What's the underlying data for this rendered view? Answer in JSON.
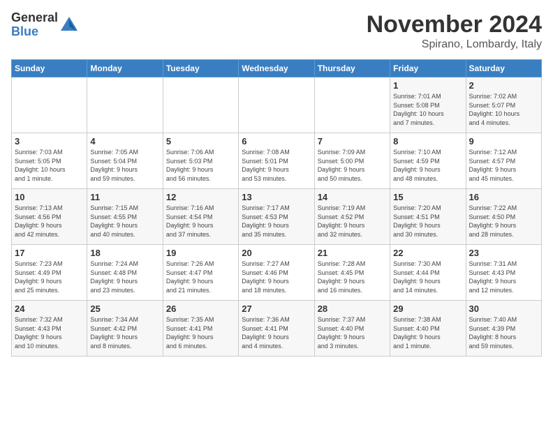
{
  "header": {
    "logo_general": "General",
    "logo_blue": "Blue",
    "month_title": "November 2024",
    "location": "Spirano, Lombardy, Italy"
  },
  "weekdays": [
    "Sunday",
    "Monday",
    "Tuesday",
    "Wednesday",
    "Thursday",
    "Friday",
    "Saturday"
  ],
  "weeks": [
    [
      {
        "day": "",
        "info": ""
      },
      {
        "day": "",
        "info": ""
      },
      {
        "day": "",
        "info": ""
      },
      {
        "day": "",
        "info": ""
      },
      {
        "day": "",
        "info": ""
      },
      {
        "day": "1",
        "info": "Sunrise: 7:01 AM\nSunset: 5:08 PM\nDaylight: 10 hours\nand 7 minutes."
      },
      {
        "day": "2",
        "info": "Sunrise: 7:02 AM\nSunset: 5:07 PM\nDaylight: 10 hours\nand 4 minutes."
      }
    ],
    [
      {
        "day": "3",
        "info": "Sunrise: 7:03 AM\nSunset: 5:05 PM\nDaylight: 10 hours\nand 1 minute."
      },
      {
        "day": "4",
        "info": "Sunrise: 7:05 AM\nSunset: 5:04 PM\nDaylight: 9 hours\nand 59 minutes."
      },
      {
        "day": "5",
        "info": "Sunrise: 7:06 AM\nSunset: 5:03 PM\nDaylight: 9 hours\nand 56 minutes."
      },
      {
        "day": "6",
        "info": "Sunrise: 7:08 AM\nSunset: 5:01 PM\nDaylight: 9 hours\nand 53 minutes."
      },
      {
        "day": "7",
        "info": "Sunrise: 7:09 AM\nSunset: 5:00 PM\nDaylight: 9 hours\nand 50 minutes."
      },
      {
        "day": "8",
        "info": "Sunrise: 7:10 AM\nSunset: 4:59 PM\nDaylight: 9 hours\nand 48 minutes."
      },
      {
        "day": "9",
        "info": "Sunrise: 7:12 AM\nSunset: 4:57 PM\nDaylight: 9 hours\nand 45 minutes."
      }
    ],
    [
      {
        "day": "10",
        "info": "Sunrise: 7:13 AM\nSunset: 4:56 PM\nDaylight: 9 hours\nand 42 minutes."
      },
      {
        "day": "11",
        "info": "Sunrise: 7:15 AM\nSunset: 4:55 PM\nDaylight: 9 hours\nand 40 minutes."
      },
      {
        "day": "12",
        "info": "Sunrise: 7:16 AM\nSunset: 4:54 PM\nDaylight: 9 hours\nand 37 minutes."
      },
      {
        "day": "13",
        "info": "Sunrise: 7:17 AM\nSunset: 4:53 PM\nDaylight: 9 hours\nand 35 minutes."
      },
      {
        "day": "14",
        "info": "Sunrise: 7:19 AM\nSunset: 4:52 PM\nDaylight: 9 hours\nand 32 minutes."
      },
      {
        "day": "15",
        "info": "Sunrise: 7:20 AM\nSunset: 4:51 PM\nDaylight: 9 hours\nand 30 minutes."
      },
      {
        "day": "16",
        "info": "Sunrise: 7:22 AM\nSunset: 4:50 PM\nDaylight: 9 hours\nand 28 minutes."
      }
    ],
    [
      {
        "day": "17",
        "info": "Sunrise: 7:23 AM\nSunset: 4:49 PM\nDaylight: 9 hours\nand 25 minutes."
      },
      {
        "day": "18",
        "info": "Sunrise: 7:24 AM\nSunset: 4:48 PM\nDaylight: 9 hours\nand 23 minutes."
      },
      {
        "day": "19",
        "info": "Sunrise: 7:26 AM\nSunset: 4:47 PM\nDaylight: 9 hours\nand 21 minutes."
      },
      {
        "day": "20",
        "info": "Sunrise: 7:27 AM\nSunset: 4:46 PM\nDaylight: 9 hours\nand 18 minutes."
      },
      {
        "day": "21",
        "info": "Sunrise: 7:28 AM\nSunset: 4:45 PM\nDaylight: 9 hours\nand 16 minutes."
      },
      {
        "day": "22",
        "info": "Sunrise: 7:30 AM\nSunset: 4:44 PM\nDaylight: 9 hours\nand 14 minutes."
      },
      {
        "day": "23",
        "info": "Sunrise: 7:31 AM\nSunset: 4:43 PM\nDaylight: 9 hours\nand 12 minutes."
      }
    ],
    [
      {
        "day": "24",
        "info": "Sunrise: 7:32 AM\nSunset: 4:43 PM\nDaylight: 9 hours\nand 10 minutes."
      },
      {
        "day": "25",
        "info": "Sunrise: 7:34 AM\nSunset: 4:42 PM\nDaylight: 9 hours\nand 8 minutes."
      },
      {
        "day": "26",
        "info": "Sunrise: 7:35 AM\nSunset: 4:41 PM\nDaylight: 9 hours\nand 6 minutes."
      },
      {
        "day": "27",
        "info": "Sunrise: 7:36 AM\nSunset: 4:41 PM\nDaylight: 9 hours\nand 4 minutes."
      },
      {
        "day": "28",
        "info": "Sunrise: 7:37 AM\nSunset: 4:40 PM\nDaylight: 9 hours\nand 3 minutes."
      },
      {
        "day": "29",
        "info": "Sunrise: 7:38 AM\nSunset: 4:40 PM\nDaylight: 9 hours\nand 1 minute."
      },
      {
        "day": "30",
        "info": "Sunrise: 7:40 AM\nSunset: 4:39 PM\nDaylight: 8 hours\nand 59 minutes."
      }
    ]
  ]
}
